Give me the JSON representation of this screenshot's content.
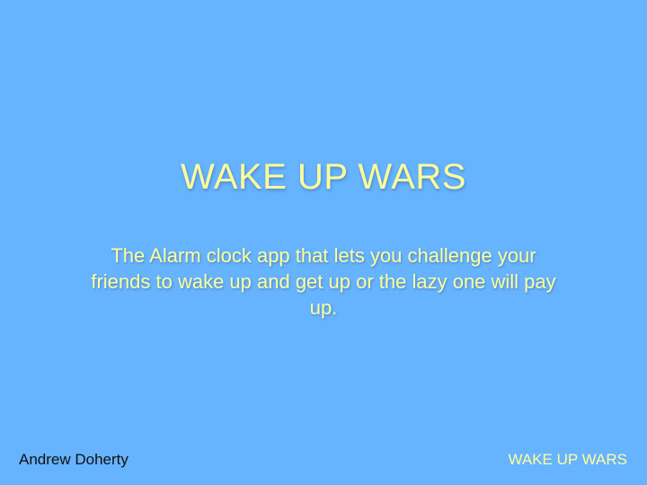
{
  "slide": {
    "title": "WAKE UP WARS",
    "subtitle": "The Alarm clock app that lets you challenge your friends to wake up and get up or the lazy one will pay up.",
    "footer_left": "Andrew Doherty",
    "footer_right": "WAKE UP WARS"
  },
  "colors": {
    "background": "#66b3ff",
    "accent_text": "#ffff99",
    "footer_text": "#111111"
  }
}
